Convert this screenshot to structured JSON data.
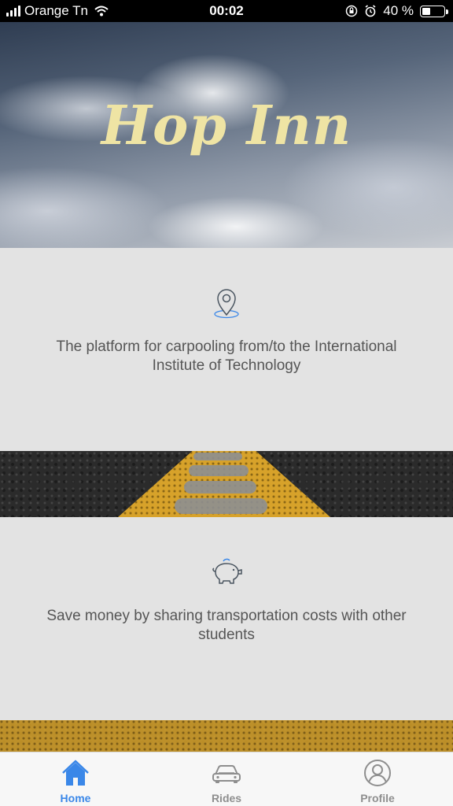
{
  "status_bar": {
    "carrier": "Orange Tn",
    "time": "00:02",
    "battery": "40 %",
    "battery_level": 0.4
  },
  "hero": {
    "title": "Hop Inn"
  },
  "features": [
    {
      "icon": "map-pin-icon",
      "text": "The platform for carpooling from/to the International Institute of Technology"
    },
    {
      "icon": "piggy-bank-icon",
      "text": "Save money by sharing transportation costs with other students"
    }
  ],
  "tab_bar": {
    "items": [
      {
        "label": "Home",
        "icon": "home-icon",
        "active": true
      },
      {
        "label": "Rides",
        "icon": "car-icon",
        "active": false
      },
      {
        "label": "Profile",
        "icon": "user-icon",
        "active": false
      }
    ]
  },
  "colors": {
    "accent": "#3a87e8",
    "title": "#efe4a4",
    "card_bg": "#e3e3e3",
    "tab_inactive": "#8e8e8e"
  }
}
